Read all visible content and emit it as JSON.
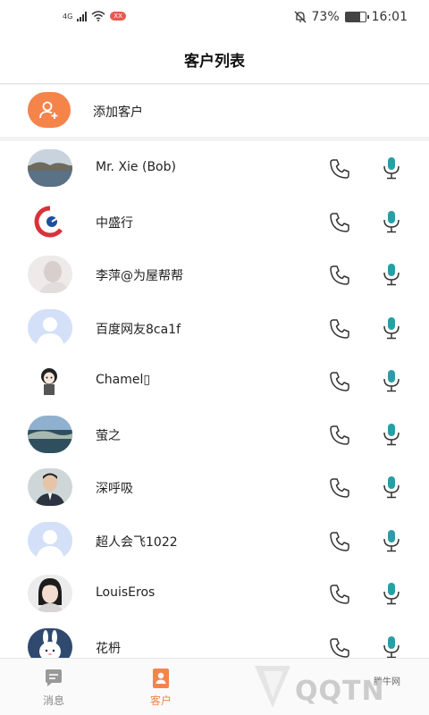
{
  "status_bar": {
    "network": "4G",
    "badge": "XX",
    "battery": "73%",
    "battery_level": 0.73,
    "time": "16:01"
  },
  "header": {
    "title": "客户列表"
  },
  "add_customer": {
    "label": "添加客户",
    "icon": "add-user-icon",
    "color": "#f5844b"
  },
  "customers": [
    {
      "name": "Mr. Xie (Bob)",
      "avatar": "lake-photo"
    },
    {
      "name": "中盛行",
      "avatar": "logo-red-blue"
    },
    {
      "name": "李萍@为屋帮帮",
      "avatar": "person-photo-faded"
    },
    {
      "name": "百度网友8ca1f",
      "avatar": "default-avatar"
    },
    {
      "name": "Chamel▯",
      "avatar": "cartoon-girl"
    },
    {
      "name": "萤之",
      "avatar": "seascape-photo"
    },
    {
      "name": "深呼吸",
      "avatar": "man-photo"
    },
    {
      "name": "超人会飞1022",
      "avatar": "default-avatar"
    },
    {
      "name": "LouisEros",
      "avatar": "woman-photo"
    },
    {
      "name": "花枬",
      "avatar": "rabbit-cartoon"
    }
  ],
  "row_actions": {
    "call_icon": "phone-icon",
    "voice_icon": "microphone-icon",
    "mic_color": "#2a9ea6"
  },
  "tabs": [
    {
      "label": "消息",
      "icon": "chat-icon",
      "active": false
    },
    {
      "label": "客户",
      "icon": "contact-card-icon",
      "active": true
    }
  ],
  "watermark": {
    "text": "QQTN",
    "small": "腾牛网"
  }
}
